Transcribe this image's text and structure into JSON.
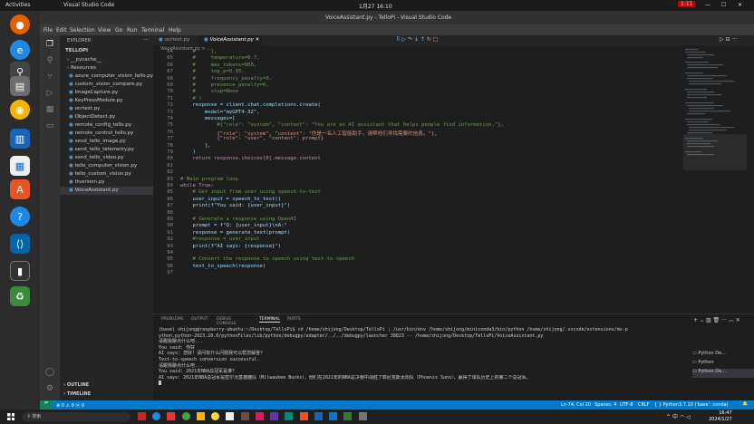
{
  "topbar": {
    "activities": "Activities",
    "app": "Visual Studio Code",
    "datetime": "1月27 16:10",
    "badge": "1:11"
  },
  "window": {
    "title": "VoiceAssistant.py - TelloPi - Visual Studio Code"
  },
  "menu": [
    "File",
    "Edit",
    "Selection",
    "View",
    "Go",
    "Run",
    "Terminal",
    "Help"
  ],
  "sidebar": {
    "header": "EXPLORER",
    "root": "TELLOPI",
    "items": [
      "__pycache__",
      "Resources",
      "azure_computer_vision_tello.py",
      "custom_vision_compare.py",
      "ImageCapture.py",
      "KeyPressModule.py",
      "ocrtest.py",
      "ObjectDetect.py",
      "remote_config_tello.py",
      "remote_control_tello.py",
      "send_tello_image.py",
      "send_tello_telemetry.py",
      "send_tello_video.py",
      "tello_computer_vision.py",
      "tello_custom_vision.py",
      "ttversion.py",
      "VoiceAssistant.py"
    ],
    "outline": "OUTLINE",
    "timeline": "TIMELINE"
  },
  "tabs": [
    {
      "label": "ocrtest.py"
    },
    {
      "label": "VoiceAssistant.py"
    }
  ],
  "breadcrumb": "VoiceAssistant.py > ...",
  "code": [
    {
      "n": "64",
      "t": "    #     ],"
    },
    {
      "n": "65",
      "t": "    #     temperature=0.7,"
    },
    {
      "n": "66",
      "t": "    #     max_tokens=800,"
    },
    {
      "n": "67",
      "t": "    #     top_p=0.95,"
    },
    {
      "n": "68",
      "t": "    #     frequency_penalty=0,"
    },
    {
      "n": "69",
      "t": "    #     presence_penalty=0,"
    },
    {
      "n": "70",
      "t": "    #     stop=None"
    },
    {
      "n": "71",
      "t": "    # )"
    },
    {
      "n": "72",
      "t": "    response = client.chat.completions.create("
    },
    {
      "n": "73",
      "t": "        model=\"myGPT4-32\","
    },
    {
      "n": "74",
      "t": "        messages=["
    },
    {
      "n": "75",
      "t": "            #{\"role\": \"system\", \"content\": \"You are an AI assistant that helps people find information.\"},"
    },
    {
      "n": "76",
      "t": "            {\"role\": \"system\", \"content\": \"你是一名人工智能助手，请帮他们寻找需要的信息。\"},"
    },
    {
      "n": "77",
      "t": "            {\"role\": \"user\", \"content\": prompt}"
    },
    {
      "n": "78",
      "t": "        ],"
    },
    {
      "n": "79",
      "t": "    )"
    },
    {
      "n": "80",
      "t": "    return response.choices[0].message.content"
    },
    {
      "n": "81",
      "t": ""
    },
    {
      "n": "82",
      "t": ""
    },
    {
      "n": "83",
      "t": "# Main program loop"
    },
    {
      "n": "84",
      "t": "while True:"
    },
    {
      "n": "85",
      "t": "    # Get input from user using speech-to-text"
    },
    {
      "n": "86",
      "t": "    user_input = speech_to_text()"
    },
    {
      "n": "87",
      "t": "    print(f\"You said: {user_input}\")"
    },
    {
      "n": "88",
      "t": ""
    },
    {
      "n": "89",
      "t": "    # Generate a response using OpenAI"
    },
    {
      "n": "90",
      "t": "    prompt = f\"Q: {user_input}\\nA:\""
    },
    {
      "n": "91",
      "t": "    response = generate_text(prompt)"
    },
    {
      "n": "92",
      "t": "    #response = user_input"
    },
    {
      "n": "93",
      "t": "    print(f\"AI says: {response}\")"
    },
    {
      "n": "94",
      "t": ""
    },
    {
      "n": "95",
      "t": "    # Convert the response to speech using text-to-speech"
    },
    {
      "n": "96",
      "t": "    text_to_speech(response)"
    },
    {
      "n": "97",
      "t": ""
    }
  ],
  "panel": {
    "tabs": [
      "PROBLEMS",
      "OUTPUT",
      "DEBUG CONSOLE",
      "TERMINAL",
      "PORTS"
    ],
    "active": "TERMINAL",
    "terminal": [
      "(base) shijong@raspberry-ubuntu:~/Desktop/TelloPi$  cd /home/shijong/Desktop/TelloPi ; /usr/bin/env /home/shijong/miniconda3/bin/python /home/shijong/.vscode/extensions/ms-p",
      "ython.python-2023.20.0/pythonFiles/lib/python/debugpy/adapter/../../debugpy/launcher 38823 -- /home/shijong/Desktop/TelloPi/VoiceAssistant.py",
      "请跟我聊点什么吧...",
      "You said: 你好",
      "AI says: 您好！请问有什么问题我可以帮您解答？",
      "Text-to-speech conversion successful.",
      "请跟我聊点什么吧...",
      "You said: 2021年NBA总冠军是谁？",
      "AI says: 2021年NBA总冠军是密尔沃基雄鹿队（Milwaukee Bucks），他们在2021年的NBA总决赛中战胜了菲尼克斯太阳队（Phoenix Suns），赢得了球队历史上的第二个总冠军。"
    ],
    "sessions": [
      "Python De...",
      "Python",
      "Python De..."
    ]
  },
  "status": {
    "left": "⊗ 0 ⚠ 0  ⓦ 0",
    "items": [
      "Ln 74, Col 20",
      "Spaces: 4",
      "UTF-8",
      "CRLF",
      "{ } Python",
      "3.7.10 ('base': conda)"
    ]
  },
  "taskbar": {
    "search": "搜索",
    "time": "16:47",
    "date": "2024/1/27"
  },
  "colors": {
    "accent": "#007acc",
    "keyword": "#c586c0",
    "string": "#ce9178",
    "comment": "#6a9955"
  }
}
